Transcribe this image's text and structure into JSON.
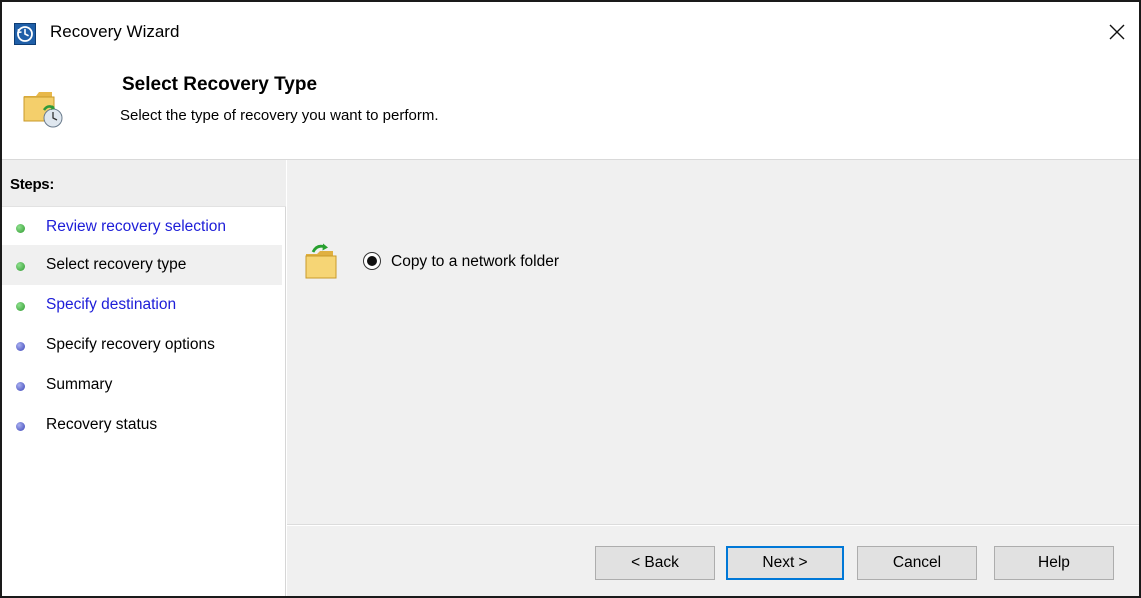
{
  "window": {
    "title": "Recovery Wizard"
  },
  "header": {
    "title": "Select Recovery Type",
    "subtitle": "Select the type of recovery you want to perform."
  },
  "steps": {
    "heading": "Steps:",
    "items": [
      {
        "label": "Review recovery selection",
        "style": "link",
        "dot": "green",
        "current": false
      },
      {
        "label": "Select recovery type",
        "style": "plain",
        "dot": "green",
        "current": true
      },
      {
        "label": "Specify destination",
        "style": "link",
        "dot": "green",
        "current": false
      },
      {
        "label": "Specify recovery options",
        "style": "plain",
        "dot": "blue",
        "current": false
      },
      {
        "label": "Summary",
        "style": "plain",
        "dot": "blue",
        "current": false
      },
      {
        "label": "Recovery status",
        "style": "plain",
        "dot": "blue",
        "current": false
      }
    ]
  },
  "recovery_option": {
    "label": "Copy to a network folder",
    "selected": true
  },
  "buttons": {
    "back": "< Back",
    "next": "Next >",
    "cancel": "Cancel",
    "help": "Help"
  },
  "colors": {
    "link": "#1d1dd8",
    "dot_green": "#3cb043",
    "dot_blue": "#4b55c8",
    "accent": "#0078d7"
  }
}
